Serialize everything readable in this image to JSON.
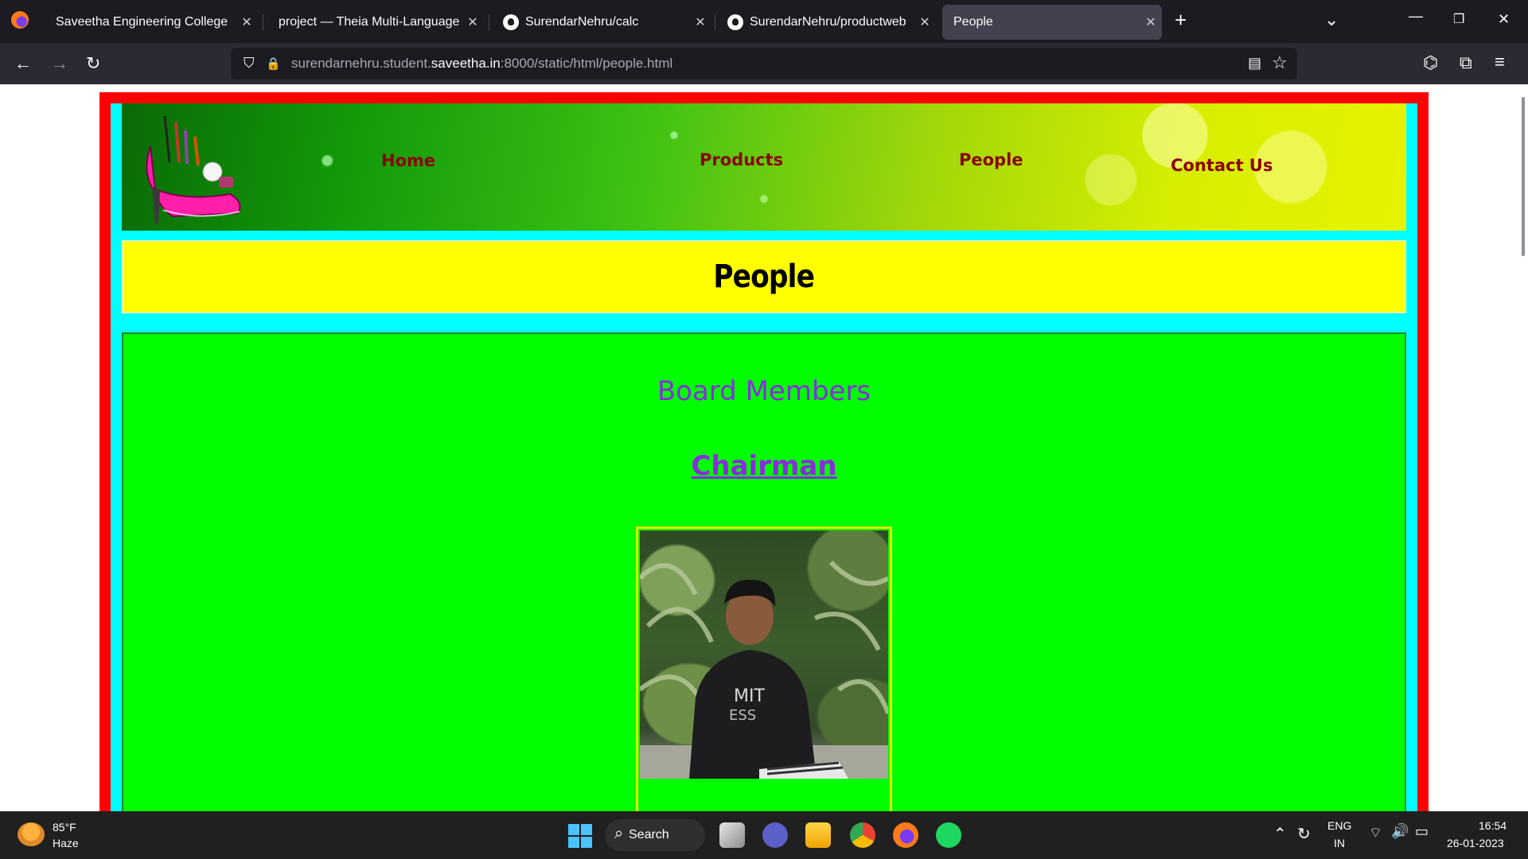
{
  "browser": {
    "tabs": [
      {
        "title": "Saveetha Engineering College",
        "active": false
      },
      {
        "title": "project — Theia Multi-Language Ex",
        "active": false
      },
      {
        "title": "SurendarNehru/calc",
        "active": false
      },
      {
        "title": "SurendarNehru/productweb",
        "active": false
      },
      {
        "title": "People",
        "active": true
      }
    ],
    "new_tab": "+",
    "list_tabs": "⌄",
    "window": {
      "minimize": "—",
      "restore": "❐",
      "close": "✕"
    },
    "nav": {
      "back": "←",
      "forward": "→",
      "reload": "↻"
    },
    "url": {
      "prefix": "surendarnehru.student.",
      "host": "saveetha.in",
      "suffix": ":8000/static/html/people.html"
    },
    "icons": {
      "shield": "⛉",
      "lock": "🔒",
      "reader": "▤",
      "bookmark": "☆",
      "pocket": "⌬",
      "extensions": "⧉",
      "menu": "≡"
    }
  },
  "page": {
    "menu": {
      "home": "Home",
      "products": "Products",
      "people": "People",
      "contact": "Contact Us"
    },
    "title": "People",
    "board_heading": "Board Members",
    "chairman_link": "Chairman"
  },
  "colors": {
    "outer_frame": "#ff0000",
    "inner_frame": "#00ffff",
    "title_bg": "#ffff00",
    "content_bg": "#00ff00",
    "menu_text": "#8b0000",
    "heading_text": "#8a2be2"
  },
  "taskbar": {
    "weather_temp": "85°F",
    "weather_desc": "Haze",
    "search_label": "Search",
    "lang": "ENG",
    "region": "IN",
    "time": "16:54",
    "date": "26-01-2023"
  }
}
